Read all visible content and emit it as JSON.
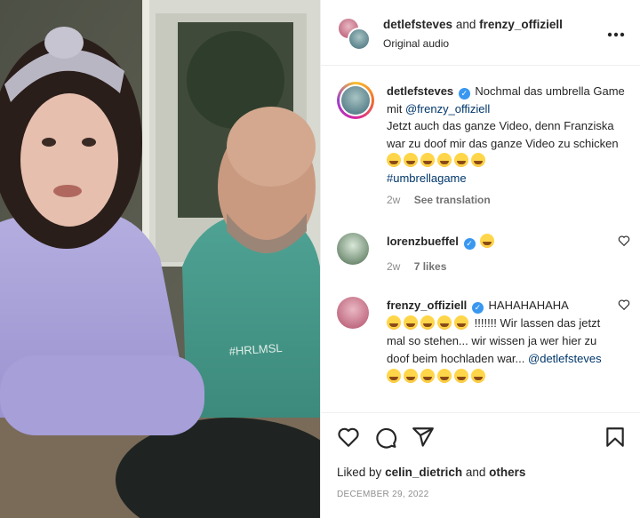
{
  "post": {
    "header": {
      "author": "detlefsteves",
      "and_text": "and",
      "collaborator": "frenzy_offiziell",
      "subtitle": "Original audio"
    },
    "caption": {
      "username": "detlefsteves",
      "text_1": "Nochmal das umbrella Game mit",
      "mention": "@frenzy_offiziell",
      "text_2": "Jetzt auch das ganze Video, denn Franziska war zu doof mir das ganze Video zu schicken",
      "hashtag": "#umbrellagame",
      "time": "2w",
      "see_translation": "See translation"
    },
    "comments": [
      {
        "username": "lorenzbueffel",
        "time": "2w",
        "likes": "7 likes"
      },
      {
        "username": "frenzy_offiziell",
        "text_1": "HAHAHAHAHA",
        "text_2": "!!!!!!! Wir lassen das jetzt mal so stehen... wir wissen ja wer hier zu doof beim hochladen war...",
        "mention": "@detlefsteves"
      }
    ],
    "liked_by": {
      "prefix": "Liked by",
      "user": "celin_dietrich",
      "and_text": "and",
      "others": "others"
    },
    "date": "DECEMBER 29, 2022"
  },
  "icons": {
    "more": "more-options-icon",
    "like": "heart-icon",
    "comment": "comment-icon",
    "share": "share-icon",
    "save": "bookmark-icon",
    "verified": "verified-badge-icon"
  },
  "colors": {
    "verified": "#3897f0",
    "link": "#00376b",
    "muted": "#8e8e8e"
  }
}
